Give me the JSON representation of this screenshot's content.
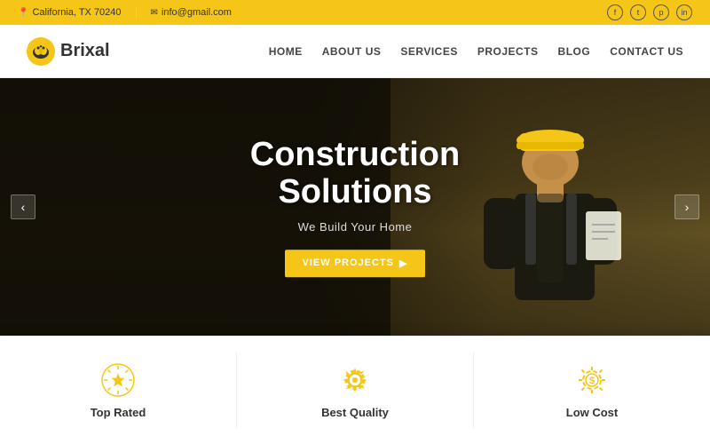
{
  "topbar": {
    "location": "California, TX 70240",
    "email": "info@gmail.com",
    "location_icon": "📍",
    "email_icon": "✉"
  },
  "social": {
    "items": [
      "f",
      "t",
      "p",
      "in"
    ]
  },
  "nav": {
    "logo_text": "Brixal",
    "links": [
      {
        "label": "HOME",
        "active": false
      },
      {
        "label": "ABOUT US",
        "active": false
      },
      {
        "label": "SERVICES",
        "active": false
      },
      {
        "label": "PROJECTS",
        "active": false
      },
      {
        "label": "BLOG",
        "active": false
      },
      {
        "label": "CONTACT US",
        "active": false
      }
    ]
  },
  "hero": {
    "title_line1": "Construction",
    "title_line2": "Solutions",
    "subtitle": "We Build Your Home",
    "btn_label": "VIEW PROJECTS",
    "arrow_prev": "‹",
    "arrow_next": "›"
  },
  "features": [
    {
      "label": "Top Rated"
    },
    {
      "label": "Best Quality"
    },
    {
      "label": "Low Cost"
    }
  ],
  "colors": {
    "accent": "#f5c518",
    "dark": "#333",
    "light": "#fff"
  }
}
